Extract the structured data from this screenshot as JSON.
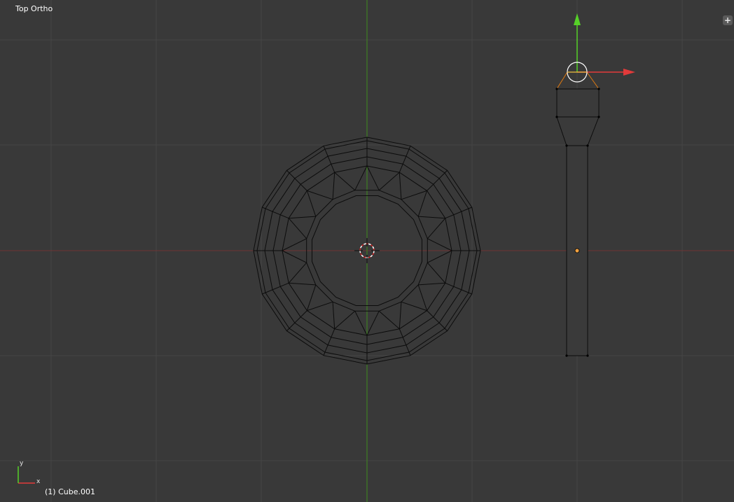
{
  "viewport": {
    "view_name": "Top Ortho",
    "active_object": "(1) Cube.001",
    "corner_widget_icon": "plus-icon"
  },
  "axes": {
    "x_label": "x",
    "y_label": "y",
    "x_color": "#e23a3a",
    "y_color": "#56d128"
  },
  "colors": {
    "background": "#393939",
    "grid": "#454545",
    "wire": "#0c0c0c",
    "origin": "#f0a040"
  }
}
